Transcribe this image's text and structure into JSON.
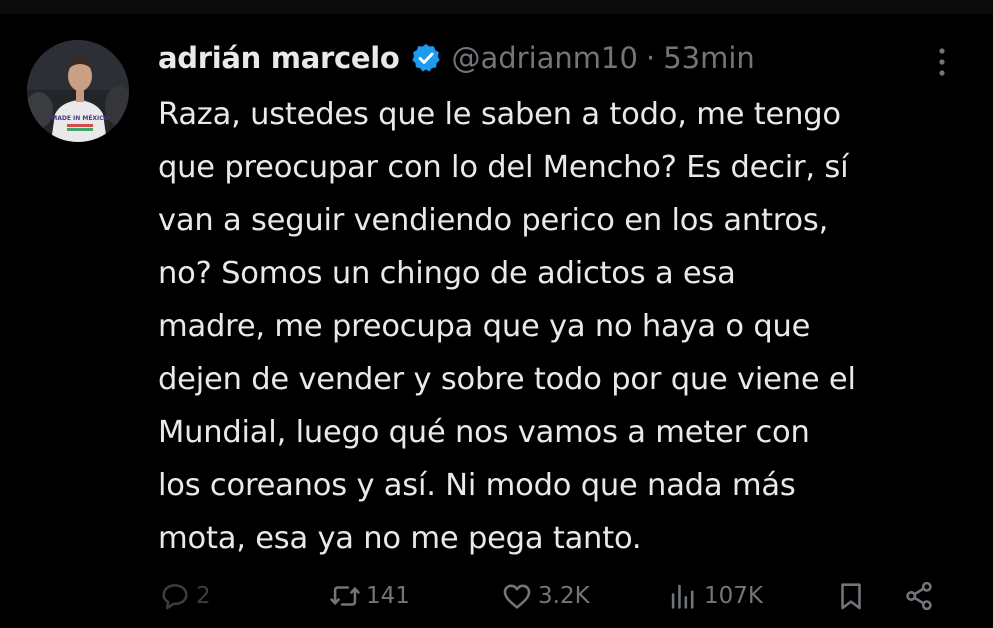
{
  "tweet": {
    "display_name": "adrián marcelo",
    "handle": "@adrianm10",
    "separator": "·",
    "time": "53min",
    "text": "Raza, ustedes que le saben a todo, me tengo\nque preocupar con lo del Mencho? Es decir, sí\nvan a seguir vendiendo perico en los antros,\nno? Somos un chingo de adictos a esa\nmadre, me preocupa que ya no haya o que\ndejen de vender y sobre todo por que viene el\nMundial, luego qué nos vamos a meter con\nlos coreanos y así. Ni modo que nada más\nmota, esa ya no me pega tanto.",
    "verified": true,
    "avatar_shirt_text": "MADE IN MÉXICO"
  },
  "actions": {
    "replies": "2",
    "retweets": "141",
    "likes": "3.2K",
    "views": "107K"
  },
  "icons": {
    "verified": "verified-badge-icon",
    "more": "more-dots-icon",
    "reply": "reply-bubble-icon",
    "retweet": "retweet-icon",
    "like": "heart-icon",
    "views": "views-chart-icon",
    "bookmark": "bookmark-icon",
    "share": "share-icon"
  },
  "colors": {
    "background": "#000000",
    "primary_text": "#e7e9ea",
    "secondary_text": "#71767b",
    "verified_blue": "#1d9bf0"
  }
}
